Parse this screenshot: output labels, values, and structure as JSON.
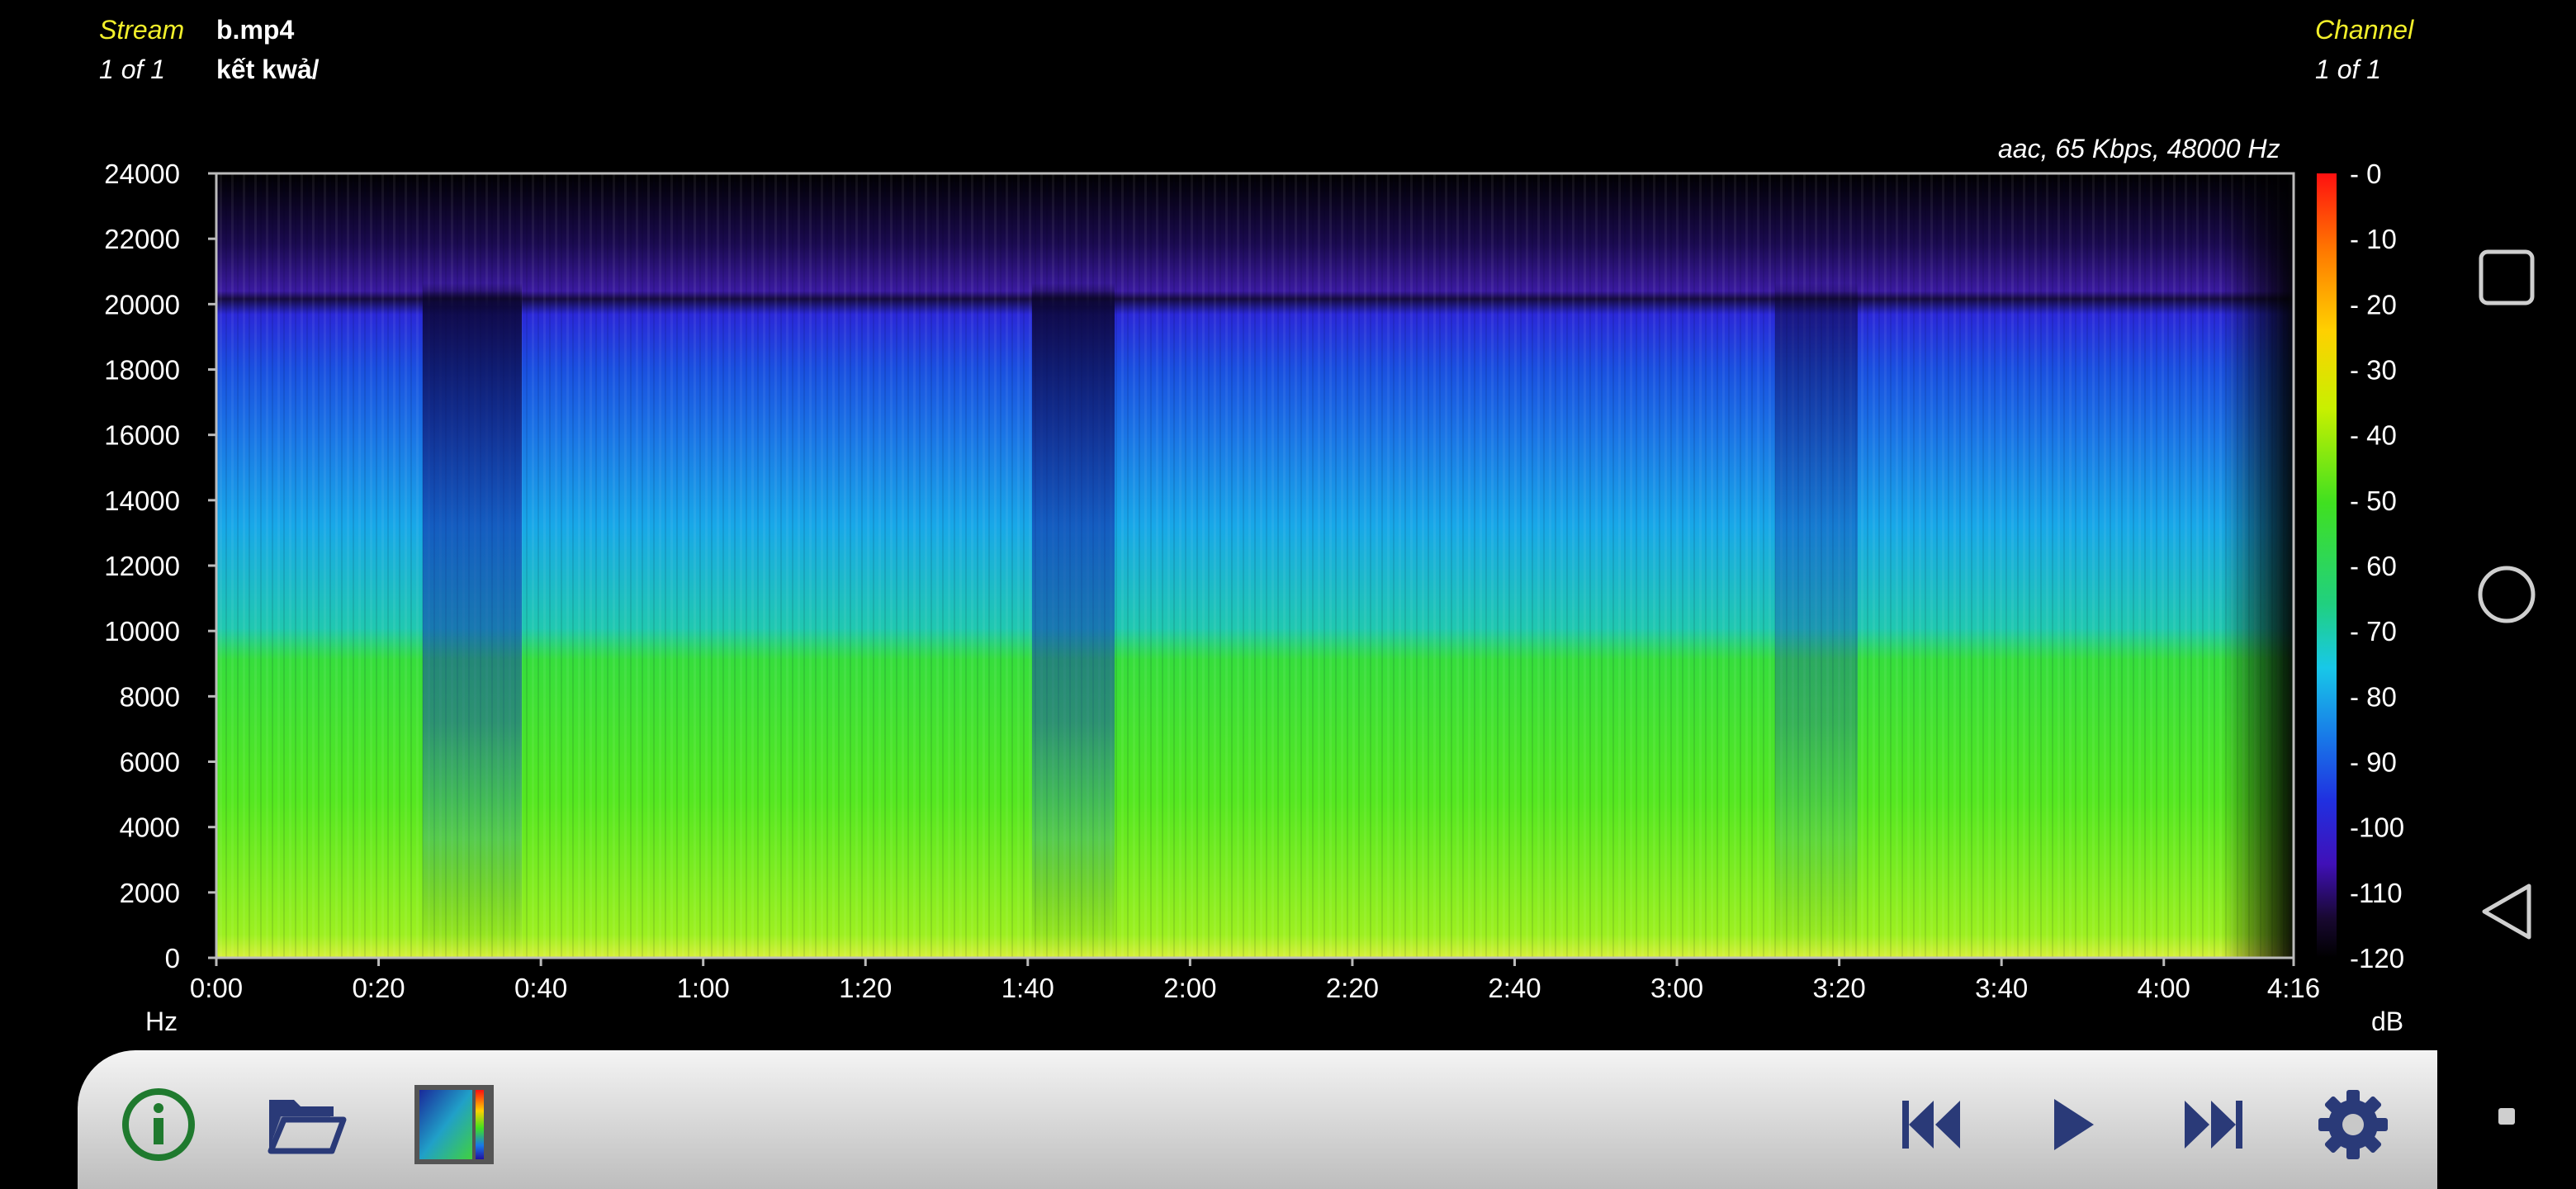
{
  "header": {
    "stream_label": "Stream",
    "stream_count": "1 of 1",
    "file_name": "b.mp4",
    "folder_name": "kết kwả/",
    "channel_label": "Channel",
    "channel_count": "1 of 1",
    "codec_info": "aac, 65 Kbps, 48000 Hz"
  },
  "axes": {
    "y_unit": "Hz",
    "y_ticks": [
      "24000",
      "22000",
      "20000",
      "18000",
      "16000",
      "14000",
      "12000",
      "10000",
      "8000",
      "6000",
      "4000",
      "2000",
      "0"
    ],
    "x_ticks": [
      "0:00",
      "0:20",
      "0:40",
      "1:00",
      "1:20",
      "1:40",
      "2:00",
      "2:20",
      "2:40",
      "3:00",
      "3:20",
      "3:40",
      "4:00",
      "4:16"
    ],
    "db_unit": "dB",
    "db_ticks": [
      "- 0",
      "- 10",
      "- 20",
      "- 30",
      "- 40",
      "- 50",
      "- 60",
      "- 70",
      "- 80",
      "- 90",
      "-100",
      "-110",
      "-120"
    ]
  },
  "colors": {
    "accent_yellow": "#f2ef2a",
    "info_green": "#1f7a2e",
    "icon_navy": "#2a3a78"
  },
  "toolbar": {
    "info_icon": "info-icon",
    "open_icon": "folder-open-icon",
    "palette_icon": "palette-icon",
    "prev_icon": "skip-previous-icon",
    "play_icon": "play-icon",
    "next_icon": "skip-next-icon",
    "settings_icon": "gear-icon"
  },
  "navigation": {
    "recents_icon": "square-icon",
    "home_icon": "circle-icon",
    "back_icon": "triangle-back-icon"
  }
}
